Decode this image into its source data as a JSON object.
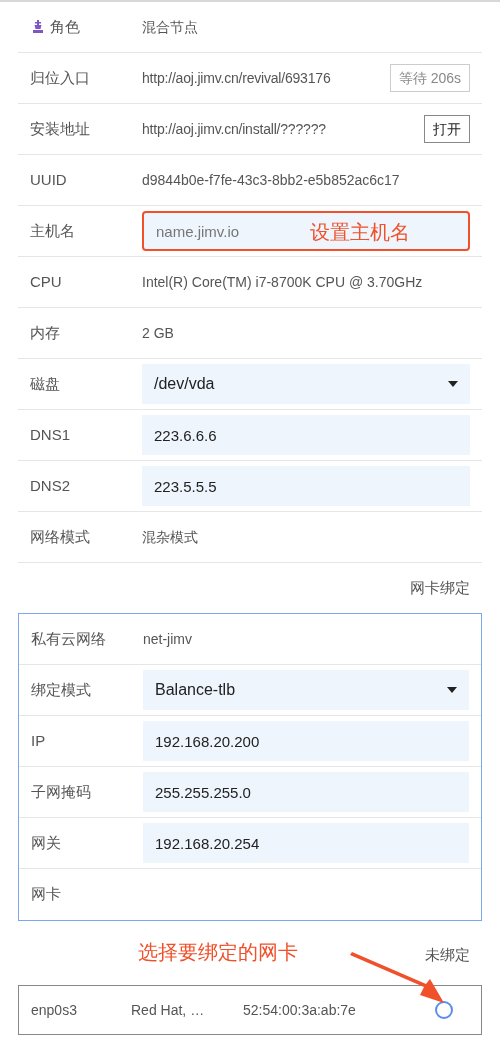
{
  "rows": [
    {
      "kind": "text",
      "icon": true,
      "label": "角色",
      "value": "混合节点"
    },
    {
      "kind": "text_button",
      "label": "归位入口",
      "value": "http://aoj.jimv.cn/revival/693176",
      "button": {
        "label": "等待 206s",
        "disabled": true
      }
    },
    {
      "kind": "text_button",
      "label": "安装地址",
      "value": "http://aoj.jimv.cn/install/??????",
      "button": {
        "label": "打开",
        "disabled": false
      }
    },
    {
      "kind": "text",
      "label": "UUID",
      "value": "d9844b0e-f7fe-43c3-8bb2-e5b852ac6c17"
    },
    {
      "kind": "input",
      "label": "主机名",
      "placeholder": "name.jimv.io",
      "note": "设置主机名"
    },
    {
      "kind": "text",
      "label": "CPU",
      "value": "Intel(R) Core(TM) i7-8700K CPU @ 3.70GHz"
    },
    {
      "kind": "text",
      "label": "内存",
      "value": "2 GB"
    },
    {
      "kind": "select",
      "label": "磁盘",
      "value": "/dev/vda"
    },
    {
      "kind": "input",
      "label": "DNS1",
      "value": "223.6.6.6"
    },
    {
      "kind": "input",
      "label": "DNS2",
      "value": "223.5.5.5"
    },
    {
      "kind": "text",
      "label": "网络模式",
      "value": "混杂模式"
    }
  ],
  "bond_link": "网卡绑定",
  "bond_rows": [
    {
      "kind": "text",
      "label": "私有云网络",
      "value": "net-jimv"
    },
    {
      "kind": "select",
      "label": "绑定模式",
      "value": "Balance-tlb"
    },
    {
      "kind": "input",
      "label": "IP",
      "value": "192.168.20.200"
    },
    {
      "kind": "input",
      "label": "子网掩码",
      "value": "255.255.255.0"
    },
    {
      "kind": "input",
      "label": "网关",
      "value": "192.168.20.254"
    },
    {
      "kind": "text",
      "label": "网卡"
    }
  ],
  "nic_note": "选择要绑定的网卡",
  "nic_status": "未绑定",
  "nics": [
    {
      "name": "enp0s3",
      "vendor": "Red Hat, …",
      "mac": "52:54:00:3a:ab:7e",
      "selected": false
    }
  ]
}
